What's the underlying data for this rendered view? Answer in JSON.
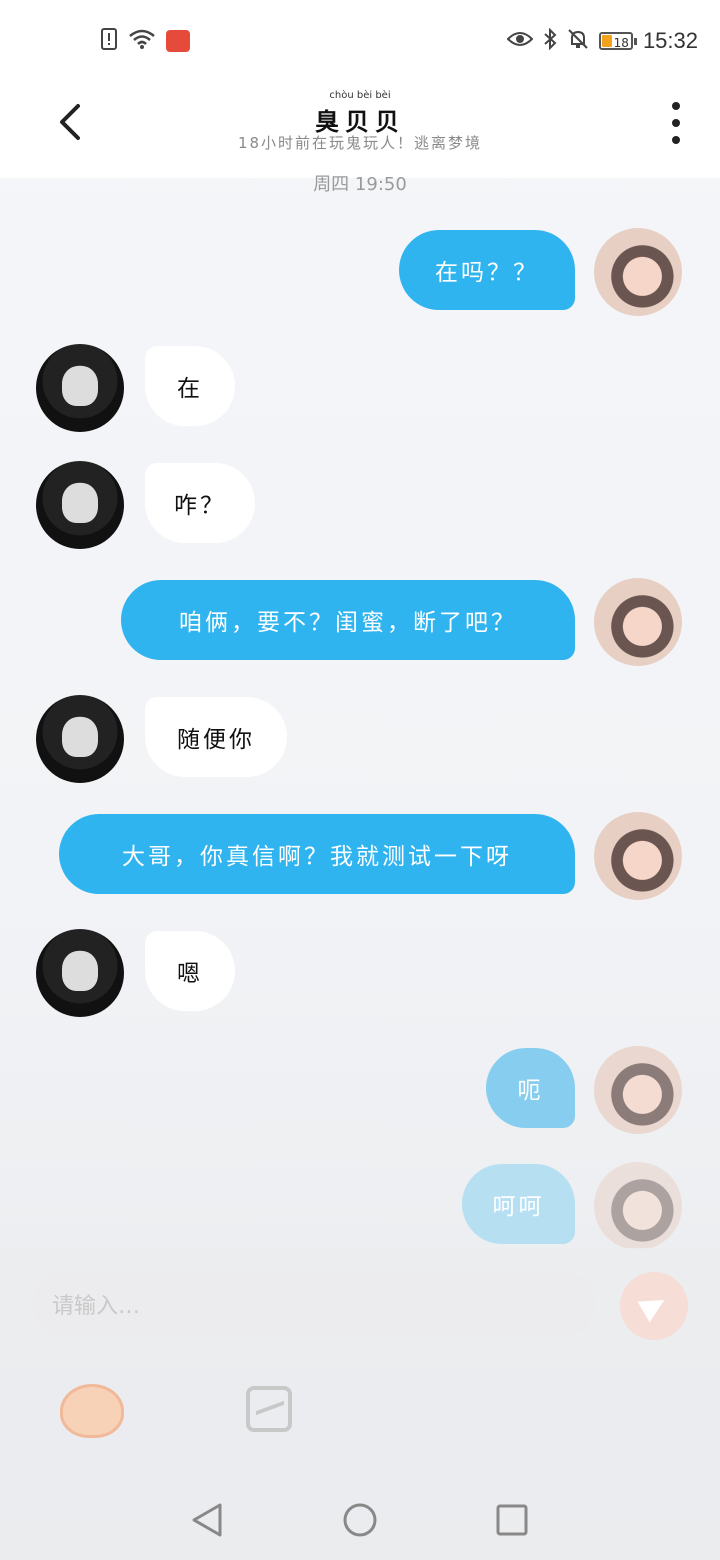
{
  "status_bar": {
    "time": "15:32",
    "battery_level": "18"
  },
  "header": {
    "title": "臭贝贝",
    "title_pinyin": "chòu bèi bèi",
    "subtitle": "18小时前在玩鬼玩人！逃离梦境"
  },
  "chat": {
    "date_label": "周四 19:50",
    "messages": [
      {
        "side": "out",
        "text": "在吗？？"
      },
      {
        "side": "in",
        "text": "在"
      },
      {
        "side": "in",
        "text": "咋？"
      },
      {
        "side": "out",
        "text": "咱俩，要不？闺蜜，断了吧？"
      },
      {
        "side": "in",
        "text": "随便你"
      },
      {
        "side": "out",
        "text": "大哥，你真信啊？我就测试一下呀"
      },
      {
        "side": "in",
        "text": "嗯"
      },
      {
        "side": "out",
        "text": "呃"
      },
      {
        "side": "out",
        "text": "呵呵"
      }
    ]
  },
  "composer": {
    "placeholder": "请输入…"
  },
  "icons": {
    "back": "chevron-left-icon",
    "more": "more-vertical-icon",
    "send": "send-icon",
    "emoji": "emoji-icon",
    "image": "image-icon"
  }
}
